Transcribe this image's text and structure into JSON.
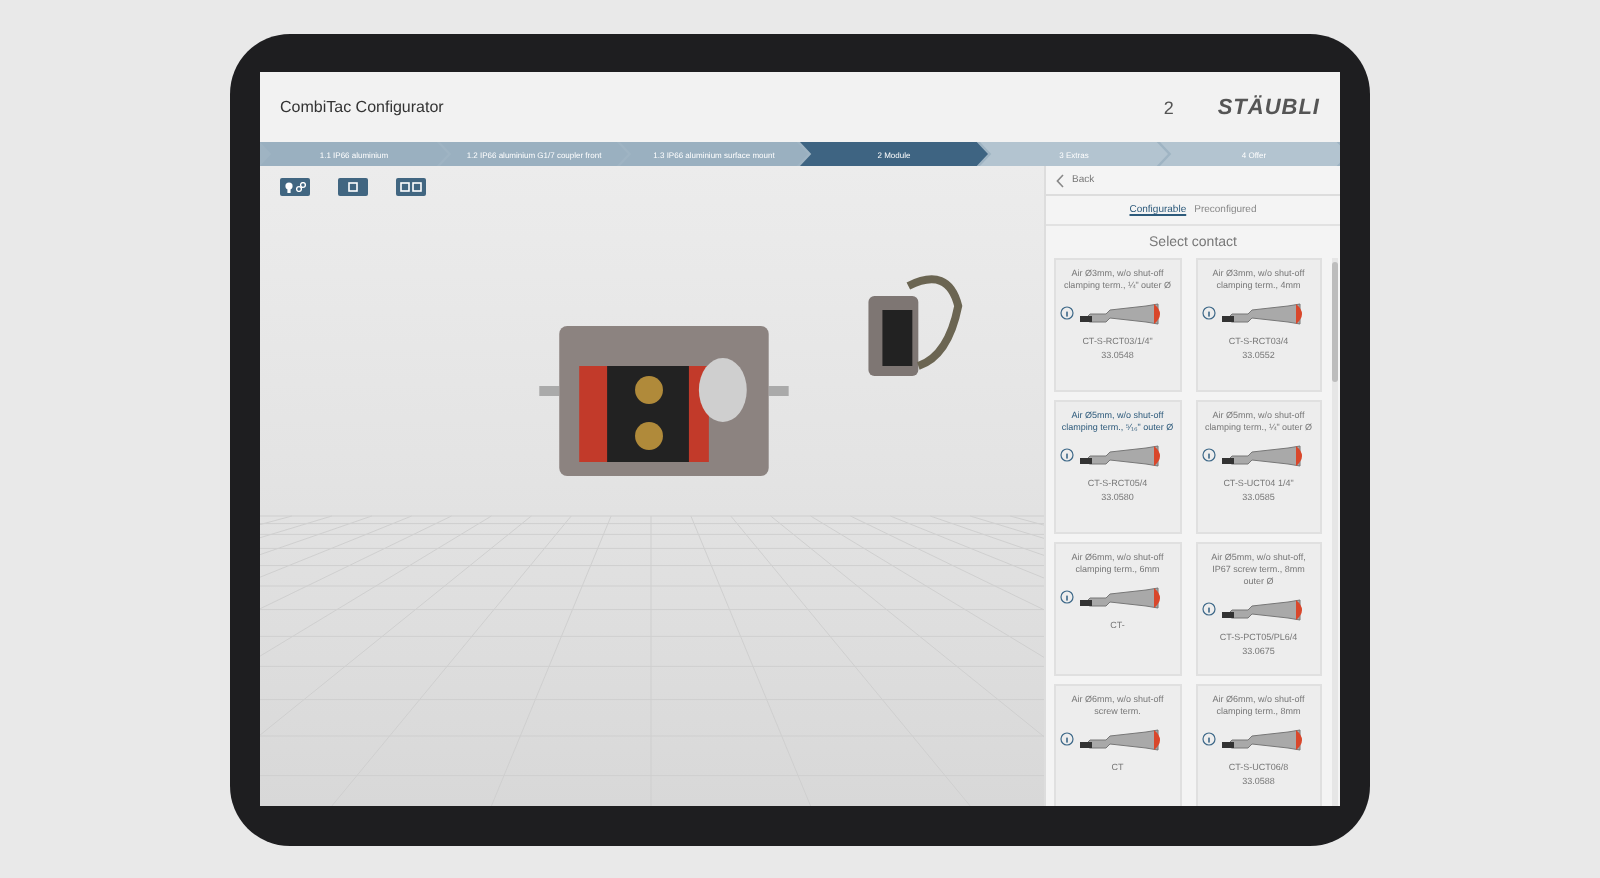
{
  "header": {
    "title": "CombiTac Configurator",
    "count": "2",
    "logo": "STÄUBLI"
  },
  "steps": [
    {
      "label": "1.1 IP66 aluminium",
      "selected": false,
      "completed": true
    },
    {
      "label": "1.2 IP66 aluminium G1/7 coupler front",
      "selected": false,
      "completed": true
    },
    {
      "label": "1.3 IP66 aluminium surface mount",
      "selected": false,
      "completed": true
    },
    {
      "label": "2 Module",
      "selected": true,
      "completed": false
    },
    {
      "label": "3 Extras",
      "selected": false,
      "completed": false
    },
    {
      "label": "4 Offer",
      "selected": false,
      "completed": false
    }
  ],
  "panel": {
    "back": "Back",
    "tabs": [
      {
        "label": "Configurable",
        "selected": true
      },
      {
        "label": "Preconfigured",
        "selected": false
      }
    ],
    "heading": "Select contact",
    "cards": [
      {
        "description": "Air Ø3mm, w/o shut-off clamping term., ¼\" outer Ø",
        "code": "CT-S-RCT03/1/4\"",
        "number": "33.0548",
        "selected": false
      },
      {
        "description": "Air Ø3mm, w/o shut-off clamping term., 4mm",
        "code": "CT-S-RCT03/4",
        "number": "33.0552",
        "selected": false
      },
      {
        "description": "Air Ø5mm, w/o shut-off clamping term., ⁵⁄₁₆\" outer Ø",
        "code": "CT-S-RCT05/4",
        "number": "33.0580",
        "selected": true
      },
      {
        "description": "Air Ø5mm, w/o shut-off clamping term., ¼\" outer Ø",
        "code": "CT-S-UCT04 1/4\"",
        "number": "33.0585",
        "selected": false
      },
      {
        "description": "Air Ø6mm, w/o shut-off clamping term., 6mm",
        "code": "CT-",
        "selected": false
      },
      {
        "description": "Air Ø5mm, w/o shut-off, IP67 screw term., 8mm outer Ø",
        "code": "CT-S-PCT05/PL6/4",
        "number": "33.0675",
        "selected": false
      },
      {
        "description": "Air Ø6mm, w/o shut-off screw term.",
        "code": "CT",
        "selected": false
      },
      {
        "description": "Air Ø6mm, w/o shut-off clamping term., 8mm",
        "code": "CT-S-UCT06/8",
        "number": "33.0588",
        "selected": false
      }
    ]
  }
}
